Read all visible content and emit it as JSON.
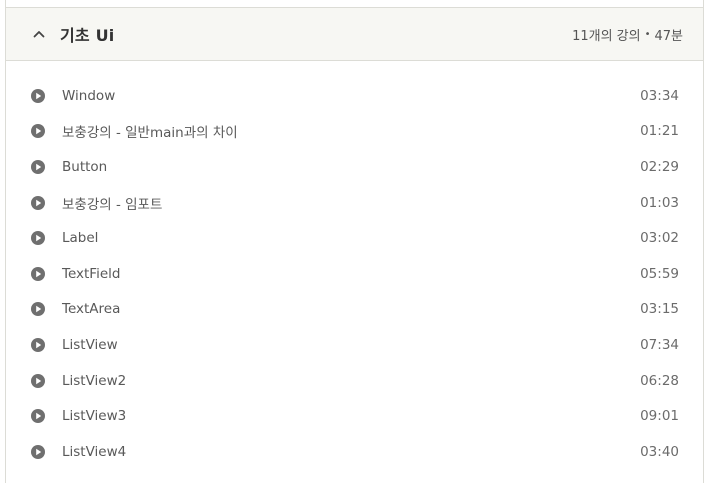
{
  "section": {
    "title": "기초 Ui",
    "lecture_count": "11개의 강의",
    "separator": "•",
    "total_time": "47분",
    "expanded": true
  },
  "lectures": [
    {
      "title": "Window",
      "duration": "03:34"
    },
    {
      "title": "보충강의 - 일반main과의 차이",
      "duration": "01:21"
    },
    {
      "title": "Button",
      "duration": "02:29"
    },
    {
      "title": "보충강의 - 임포트",
      "duration": "01:03"
    },
    {
      "title": "Label",
      "duration": "03:02"
    },
    {
      "title": "TextField",
      "duration": "05:59"
    },
    {
      "title": "TextArea",
      "duration": "03:15"
    },
    {
      "title": "ListView",
      "duration": "07:34"
    },
    {
      "title": "ListView2",
      "duration": "06:28"
    },
    {
      "title": "ListView3",
      "duration": "09:01"
    },
    {
      "title": "ListView4",
      "duration": "03:40"
    }
  ],
  "icons": {
    "header": "chevron-up-icon",
    "lecture": "play-circle-icon"
  },
  "colors": {
    "header_bg": "#f7f7f3",
    "border": "#dcdcd6",
    "icon": "#6f6f6f",
    "text": "#595959"
  }
}
